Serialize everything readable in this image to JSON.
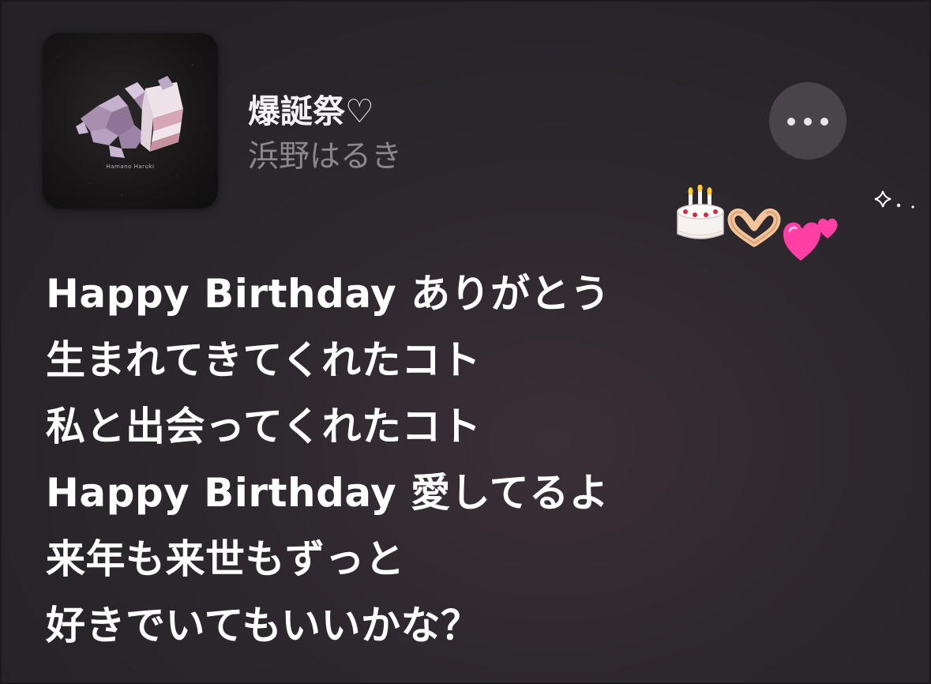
{
  "album": {
    "cover_caption": "Hamano Haruki"
  },
  "song": {
    "title": "爆誕祭♡",
    "artist": "浜野はるき"
  },
  "more_button": {
    "icon": "ellipsis-icon"
  },
  "decorations": {
    "emojis": [
      "birthday-cake-icon",
      "heart-hands-icon",
      "two-hearts-icon",
      "sparkle-icon"
    ],
    "colors": {
      "heart": "#ff3fa4",
      "cake_frosting": "#f6f2ef",
      "candle_flame": "#ffcf3a"
    }
  },
  "lyrics": [
    "Happy Birthday ありがとう",
    "生まれてきてくれたコト",
    "私と出会ってくれたコト",
    "Happy Birthday 愛してるよ",
    "来年も来世もずっと",
    "好きでいてもいいかな？"
  ]
}
